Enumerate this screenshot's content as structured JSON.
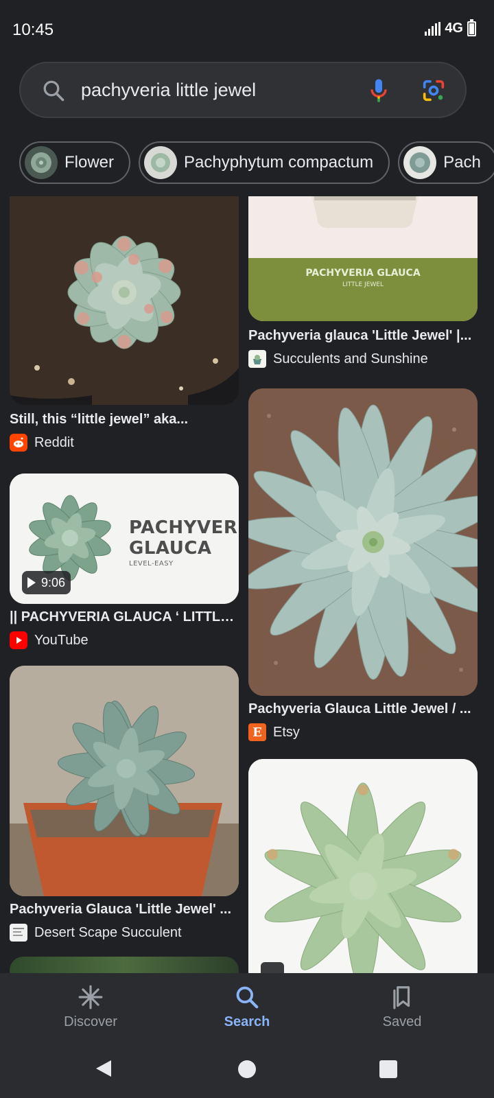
{
  "status_bar": {
    "time": "10:45",
    "network": "4G"
  },
  "search": {
    "query": "pachyveria little jewel"
  },
  "chips": [
    {
      "label": "Flower"
    },
    {
      "label": "Pachyphytum compactum"
    },
    {
      "label": "Pach"
    }
  ],
  "results": {
    "left": [
      {
        "title": "Still, this “little jewel” aka...",
        "source": "Reddit"
      },
      {
        "title": "|| PACHYVERIA GLAUCA ‘ LITTLE...",
        "source": "YouTube",
        "duration": "9:06",
        "image_text": {
          "line1": "PACHYVERIA",
          "line2": "GLAUCA",
          "line3": "LEVEL-EASY"
        }
      },
      {
        "title": "Pachyveria Glauca 'Little Jewel' ...",
        "source": "Desert Scape Succulent"
      }
    ],
    "right": [
      {
        "title": "Pachyveria glauca 'Little Jewel' |...",
        "source": "Succulents and Sunshine",
        "image_text": {
          "line1": "PACHYVERIA GLAUCA",
          "line2": "LITTLE JEWEL"
        }
      },
      {
        "title": "Pachyveria Glauca Little Jewel / ...",
        "source": "Etsy"
      },
      {
        "title": "",
        "source": ""
      }
    ]
  },
  "bottom_nav": {
    "items": [
      {
        "label": "Discover",
        "icon": "asterisk-icon",
        "active": false
      },
      {
        "label": "Search",
        "icon": "search-icon",
        "active": true
      },
      {
        "label": "Saved",
        "icon": "bookmarks-icon",
        "active": false
      }
    ]
  },
  "colors": {
    "background": "#202124",
    "accent": "#8ab4f8",
    "text": "#e8eaed",
    "muted": "#9aa0a6"
  }
}
